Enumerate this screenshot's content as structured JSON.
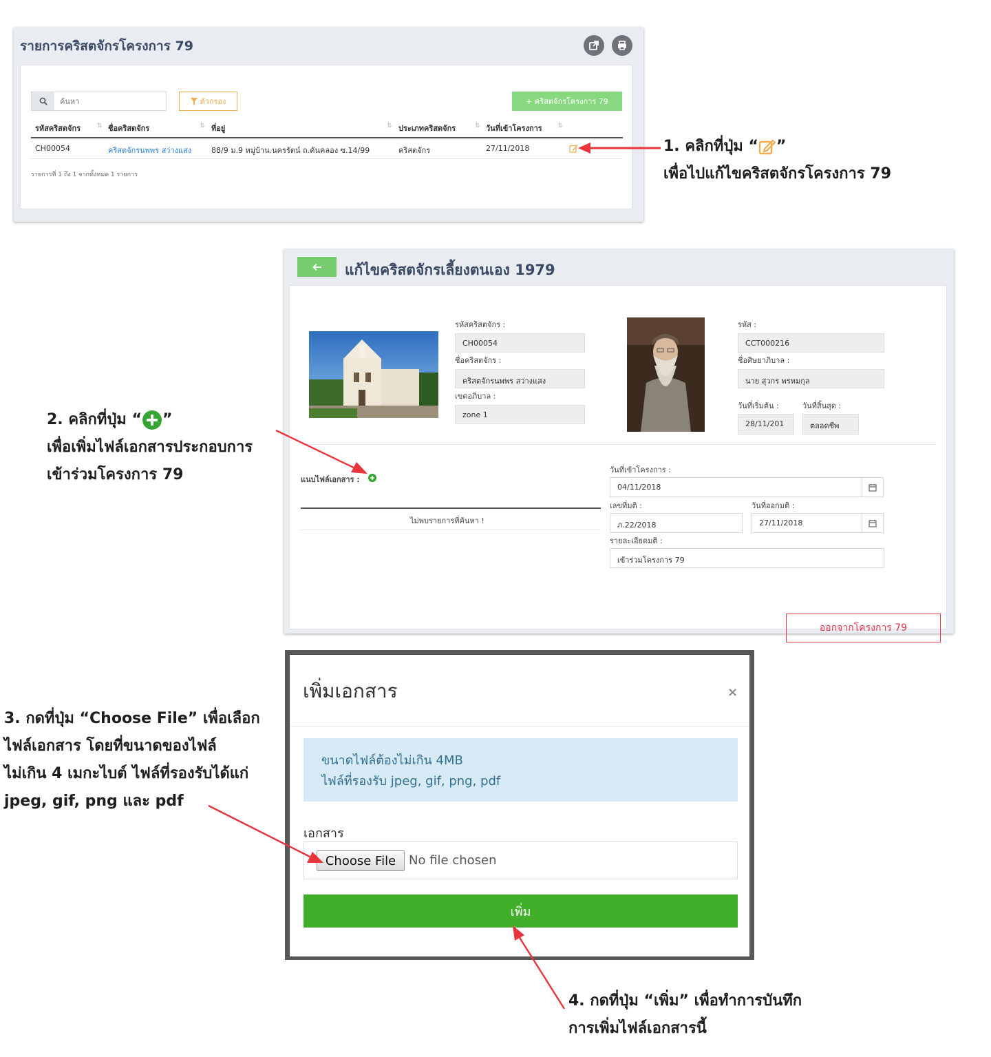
{
  "panel1": {
    "title": "รายการคริสตจักรโครงการ 79",
    "search_placeholder": "ค้นหา",
    "filter_label": "ตัวกรอง",
    "add_label": "+ คริสตจักรโครงการ 79",
    "columns": [
      "รหัสคริสตจักร",
      "ชื่อคริสตจักร",
      "ที่อยู่",
      "ประเภทคริสตจักร",
      "วันที่เข้าโครงการ"
    ],
    "row": {
      "code": "CH00054",
      "name": "คริสตจักรนพพร สว่างแสง",
      "address": "88/9 ม.9 หมู่บ้าน.นครรัตน์ ถ.คันคลอง ซ.14/99",
      "type": "คริสตจักร",
      "date": "27/11/2018"
    },
    "footer": "รายการที่ 1 ถึง 1 จากทั้งหมด 1 รายการ"
  },
  "notes": {
    "n1_line1_pre": "1. คลิกที่ปุ่ม “",
    "n1_line1_post": "”",
    "n1_line2": "เพื่อไปแก้ไขคริสตจักรโครงการ 79",
    "n2_line1_pre": "2. คลิกที่ปุ่ม “",
    "n2_line1_post": "”",
    "n2_line2": "เพื่อเพิ่มไฟล์เอกสารประกอบการ",
    "n2_line3": "เข้าร่วมโครงการ 79",
    "n3_line1": "3. กดที่ปุ่ม “Choose File” เพื่อเลือก",
    "n3_line2": "ไฟล์เอกสาร  โดยที่ขนาดของไฟล์",
    "n3_line3": "ไม่เกิน 4 เมกะไบต์ ไฟล์ที่รองรับได้แก่",
    "n3_line4": "jpeg, gif, png และ pdf",
    "n4_line1": "4. กดที่ปุ่ม “เพิ่ม” เพื่อทำการบันทึก",
    "n4_line2": "การเพิ่มไฟล์เอกสารนี้"
  },
  "panel2": {
    "title": "แก้ไขคริสตจักรเลี้ยงตนเอง 1979",
    "church_code_label": "รหัสคริสตจักร :",
    "church_code": "CH00054",
    "church_name_label": "ชื่อคริสตจักร :",
    "church_name": "คริสตจักรนพพร สว่างแสง",
    "zone_label": "เขตอภิบาล :",
    "zone": "zone 1",
    "code_label": "รหัส :",
    "code": "CCT000216",
    "pastor_label": "ชื่อศิษยาภิบาล :",
    "pastor": "นาย สุวกร พรหมกุล",
    "start_label": "วันที่เริ่มต้น :",
    "start": "28/11/201",
    "end_label": "วันที่สิ้นสุด :",
    "end": "ตลอดชีพ",
    "attach_label": "แนบไฟล์เอกสาร :",
    "no_result": "ไม่พบรายการที่ค้นหา !",
    "join_date_label": "วันที่เข้าโครงการ :",
    "join_date": "04/11/2018",
    "resolution_no_label": "เลขที่มติ :",
    "resolution_no": "ภ.22/2018",
    "resolution_date_label": "วันที่ออกมติ :",
    "resolution_date": "27/11/2018",
    "resolution_detail_label": "รายละเอียดมติ :",
    "resolution_detail": "เข้าร่วมโครงการ 79",
    "leave_label": "ออกจากโครงการ 79"
  },
  "modal": {
    "title": "เพิ่มเอกสาร",
    "close": "×",
    "info_line1": "ขนาดไฟล์ต้องไม่เกิน 4MB",
    "info_line2": "ไฟล์ที่รองรับ jpeg, gif, png, pdf",
    "doc_label": "เอกสาร",
    "choose_file": "Choose File",
    "no_file": "No file chosen",
    "add_label": "เพิ่ม"
  },
  "colors": {
    "edit_icon": "#f0ad4e",
    "plus_icon": "#33a532",
    "arrow": "#e8343a"
  }
}
